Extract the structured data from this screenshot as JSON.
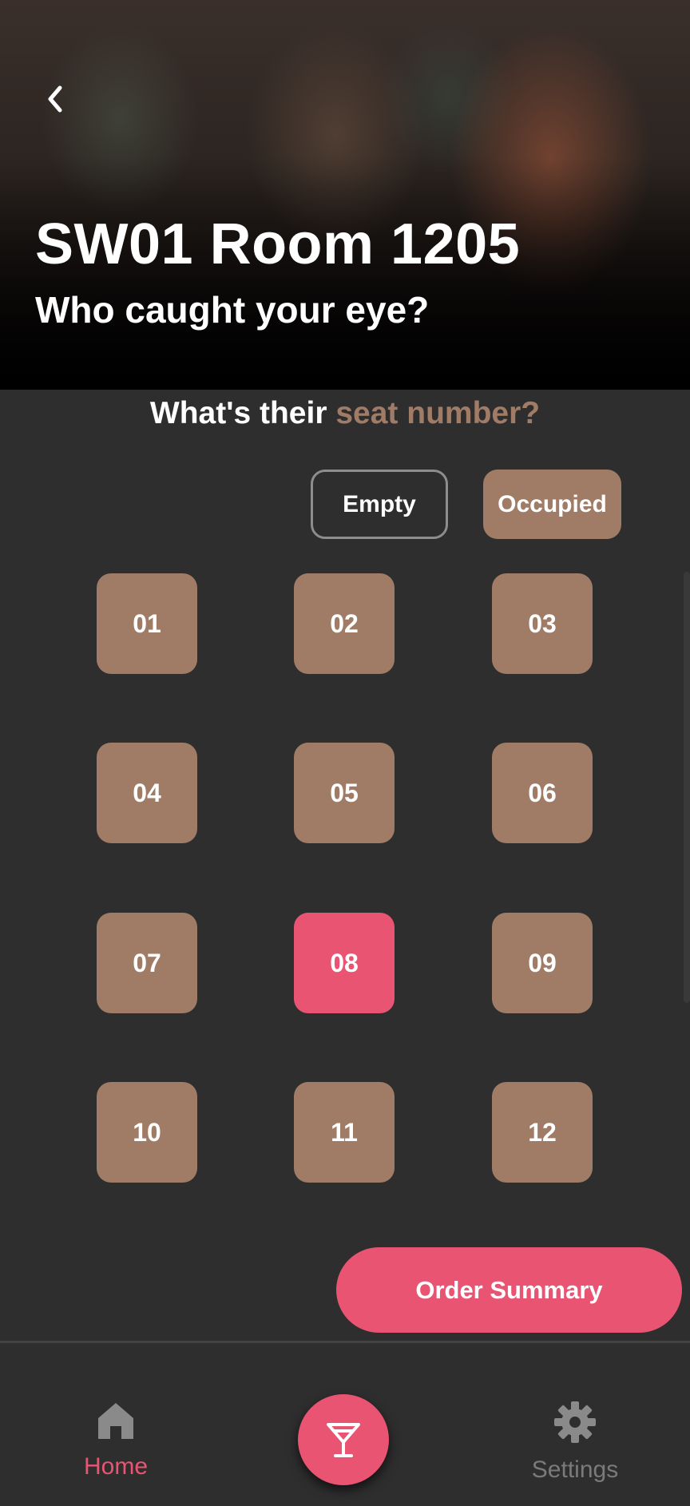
{
  "header": {
    "title": "SW01 Room 1205",
    "subtitle": "Who caught your eye?",
    "back_icon": "chevron-left-icon"
  },
  "prompt": {
    "text": "What's their ",
    "accent": "seat number?"
  },
  "legend": {
    "empty_label": "Empty",
    "occupied_label": "Occupied"
  },
  "seats": [
    {
      "label": "01",
      "status": "occupied"
    },
    {
      "label": "02",
      "status": "occupied"
    },
    {
      "label": "03",
      "status": "occupied"
    },
    {
      "label": "04",
      "status": "occupied"
    },
    {
      "label": "05",
      "status": "occupied"
    },
    {
      "label": "06",
      "status": "occupied"
    },
    {
      "label": "07",
      "status": "occupied"
    },
    {
      "label": "08",
      "status": "selected"
    },
    {
      "label": "09",
      "status": "occupied"
    },
    {
      "label": "10",
      "status": "occupied"
    },
    {
      "label": "11",
      "status": "occupied"
    },
    {
      "label": "12",
      "status": "occupied"
    }
  ],
  "order_button": "Order Summary",
  "nav": {
    "home_label": "Home",
    "settings_label": "Settings",
    "center_icon": "cocktail-glass-icon"
  },
  "colors": {
    "background": "#2f2e2f",
    "occupied": "#a07c67",
    "accent_pink": "#e95473",
    "inactive_gray": "#7b7a7b"
  }
}
